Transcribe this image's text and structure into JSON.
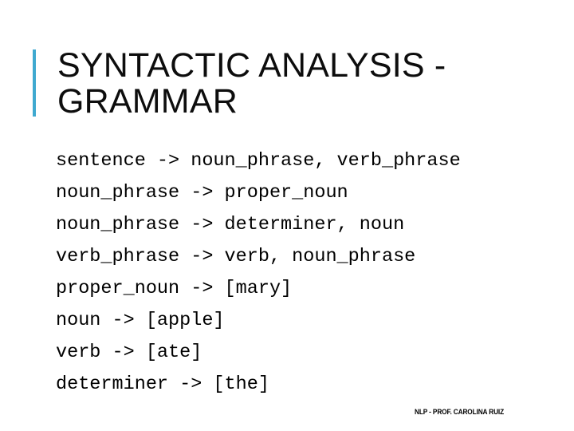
{
  "slide": {
    "background_color": "#ffffff",
    "accent_color": "#3fa9d0",
    "text_color": "#000000"
  },
  "header": {
    "title": "SYNTACTIC ANALYSIS -\nGRAMMAR",
    "accent_bar_color": "#3fa9d0"
  },
  "body": {
    "rules": [
      {
        "text": "sentence -> noun_phrase, verb_phrase"
      },
      {
        "text": "noun_phrase -> proper_noun"
      },
      {
        "text": "noun_phrase -> determiner, noun"
      },
      {
        "text": "verb_phrase -> verb, noun_phrase"
      },
      {
        "text": "proper_noun -> [mary]"
      },
      {
        "text": "noun -> [apple]"
      },
      {
        "text": "verb -> [ate]"
      },
      {
        "text": "determiner -> [the]"
      }
    ]
  },
  "footer": {
    "text": "NLP - PROF. CAROLINA RUIZ"
  }
}
